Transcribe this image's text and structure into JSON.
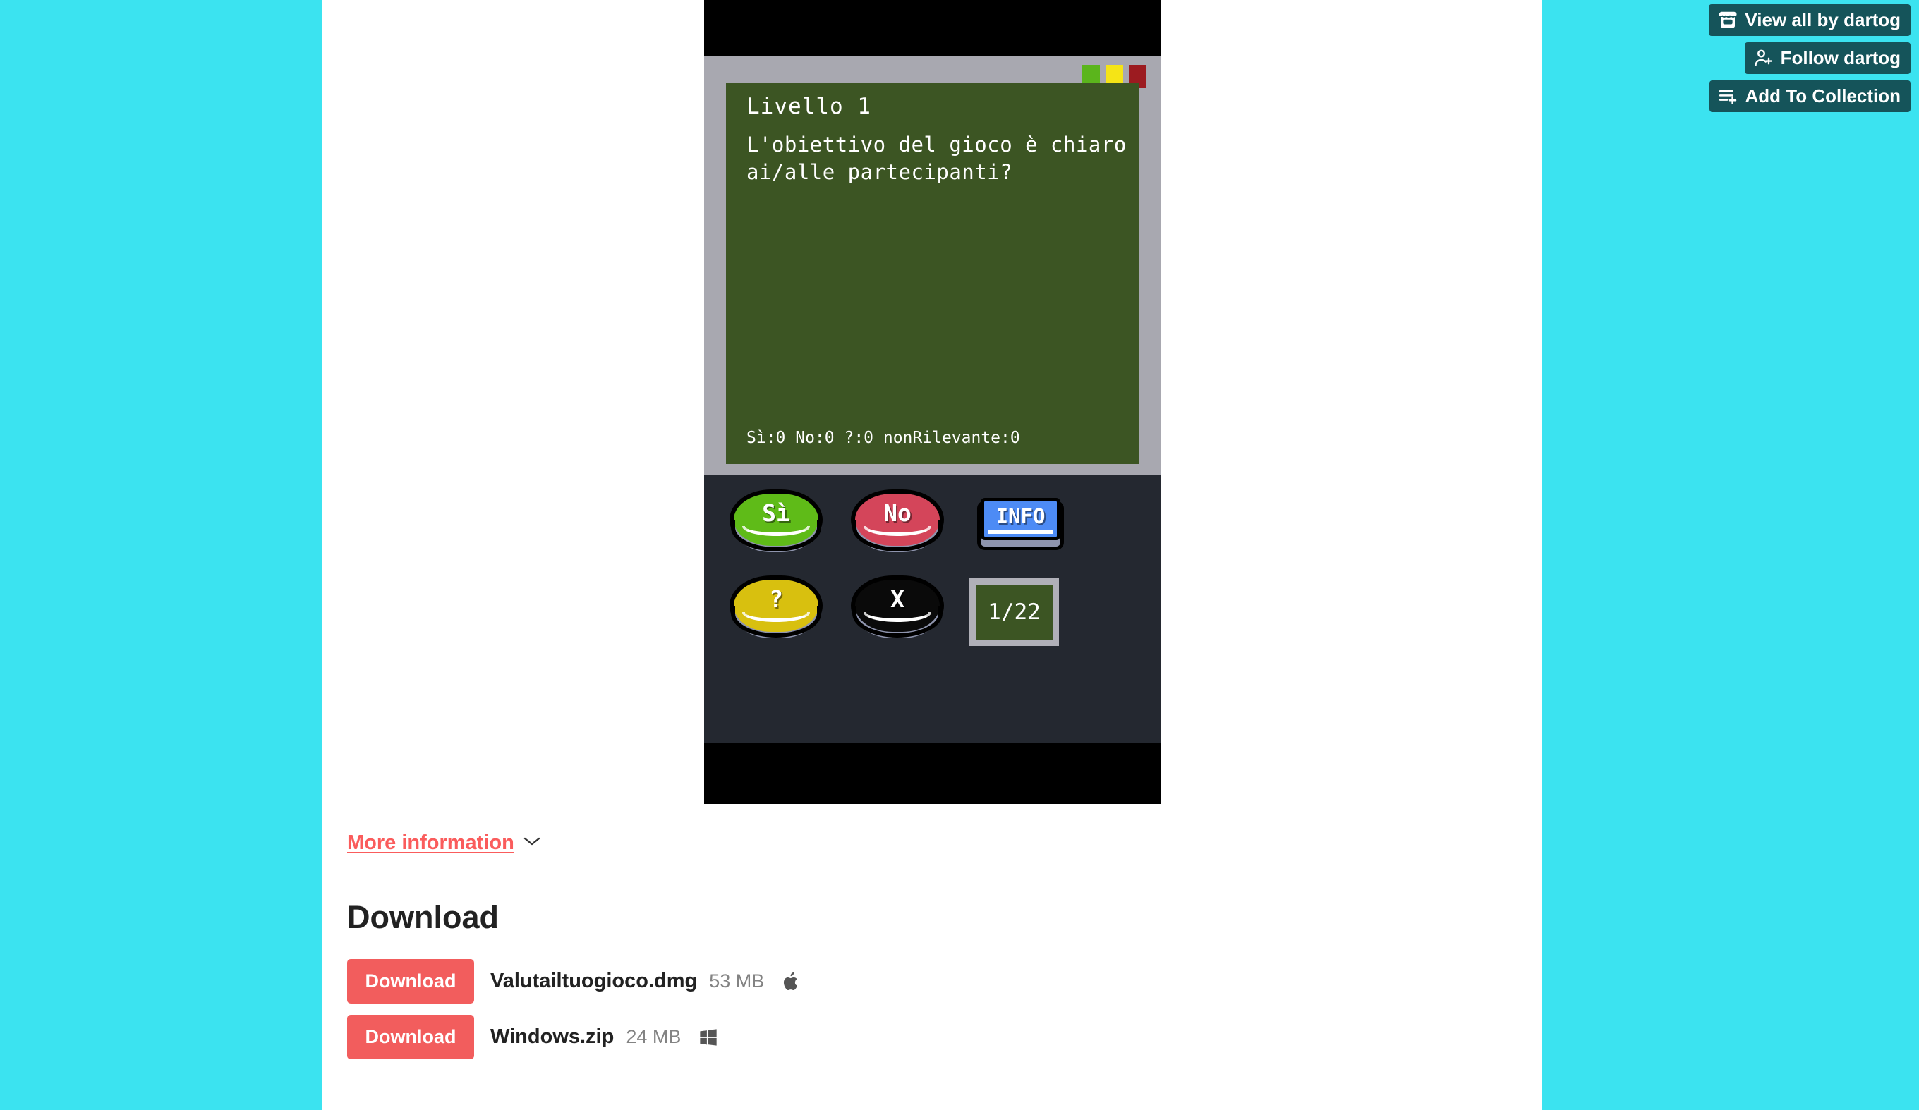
{
  "theme": {
    "page_background": "#3be3f0",
    "content_background": "#ffffff",
    "action_button_bg": "#15545a",
    "download_button_bg": "#f25d5d",
    "link_color": "#fa5c5c",
    "screen_green": "#3c5523",
    "panel_dark": "#242830",
    "frame_gray": "#a8a8b0"
  },
  "actions": [
    {
      "label": "View all by dartog",
      "icon": "itch-store-icon"
    },
    {
      "label": "Follow dartog",
      "icon": "person-add-icon"
    },
    {
      "label": "Add To Collection",
      "icon": "list-add-icon"
    }
  ],
  "game": {
    "lights": [
      {
        "name": "green-light",
        "color": "#5bb51c"
      },
      {
        "name": "yellow-light",
        "color": "#f5e416"
      },
      {
        "name": "red-light",
        "color": "#9c1b20"
      }
    ],
    "screen": {
      "title": "Livello 1",
      "body": "L'obiettivo del gioco è chiaro ai/alle partecipanti?",
      "score": "Sì:0  No:0  ?:0  nonRilevante:0"
    },
    "buttons": [
      {
        "name": "yes-button",
        "label": "Sì",
        "color": "#5fc party"
      },
      {
        "name": "no-button",
        "label": "No",
        "color": "#d4455a"
      },
      {
        "name": "info-button",
        "label": "INFO",
        "color": "#4d8bf5"
      },
      {
        "name": "question-button",
        "label": "?",
        "color": "#d8c00f"
      },
      {
        "name": "skip-button",
        "label": "X",
        "color": "#0a0a0a"
      }
    ],
    "yes_color": "#5fbb18",
    "no_color": "#d4455a",
    "question_color": "#d8c00f",
    "skip_color": "#0a0a0a",
    "counter": "1/22"
  },
  "more_information": {
    "label": "More information",
    "icon": "chevron-down-icon"
  },
  "download": {
    "heading": "Download",
    "items": [
      {
        "button_label": "Download",
        "filename": "Valutailtuogioco.dmg",
        "size": "53 MB",
        "os_icon": "apple-icon"
      },
      {
        "button_label": "Download",
        "filename": "Windows.zip",
        "size": "24 MB",
        "os_icon": "windows-icon"
      }
    ]
  }
}
